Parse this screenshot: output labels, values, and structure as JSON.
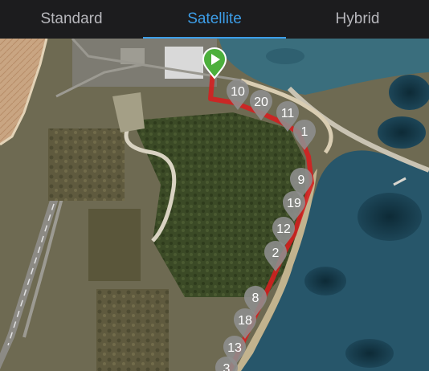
{
  "tabs": [
    {
      "label": "Standard",
      "active": false
    },
    {
      "label": "Satellite",
      "active": true
    },
    {
      "label": "Hybrid",
      "active": false
    }
  ],
  "accent_color": "#3d9ee8",
  "route_color": "#d42020",
  "start_marker": {
    "icon": "play-icon",
    "color": "#4caf3c"
  },
  "markers": [
    "10",
    "20",
    "11",
    "1",
    "9",
    "19",
    "12",
    "2",
    "8",
    "18",
    "13",
    "3"
  ]
}
